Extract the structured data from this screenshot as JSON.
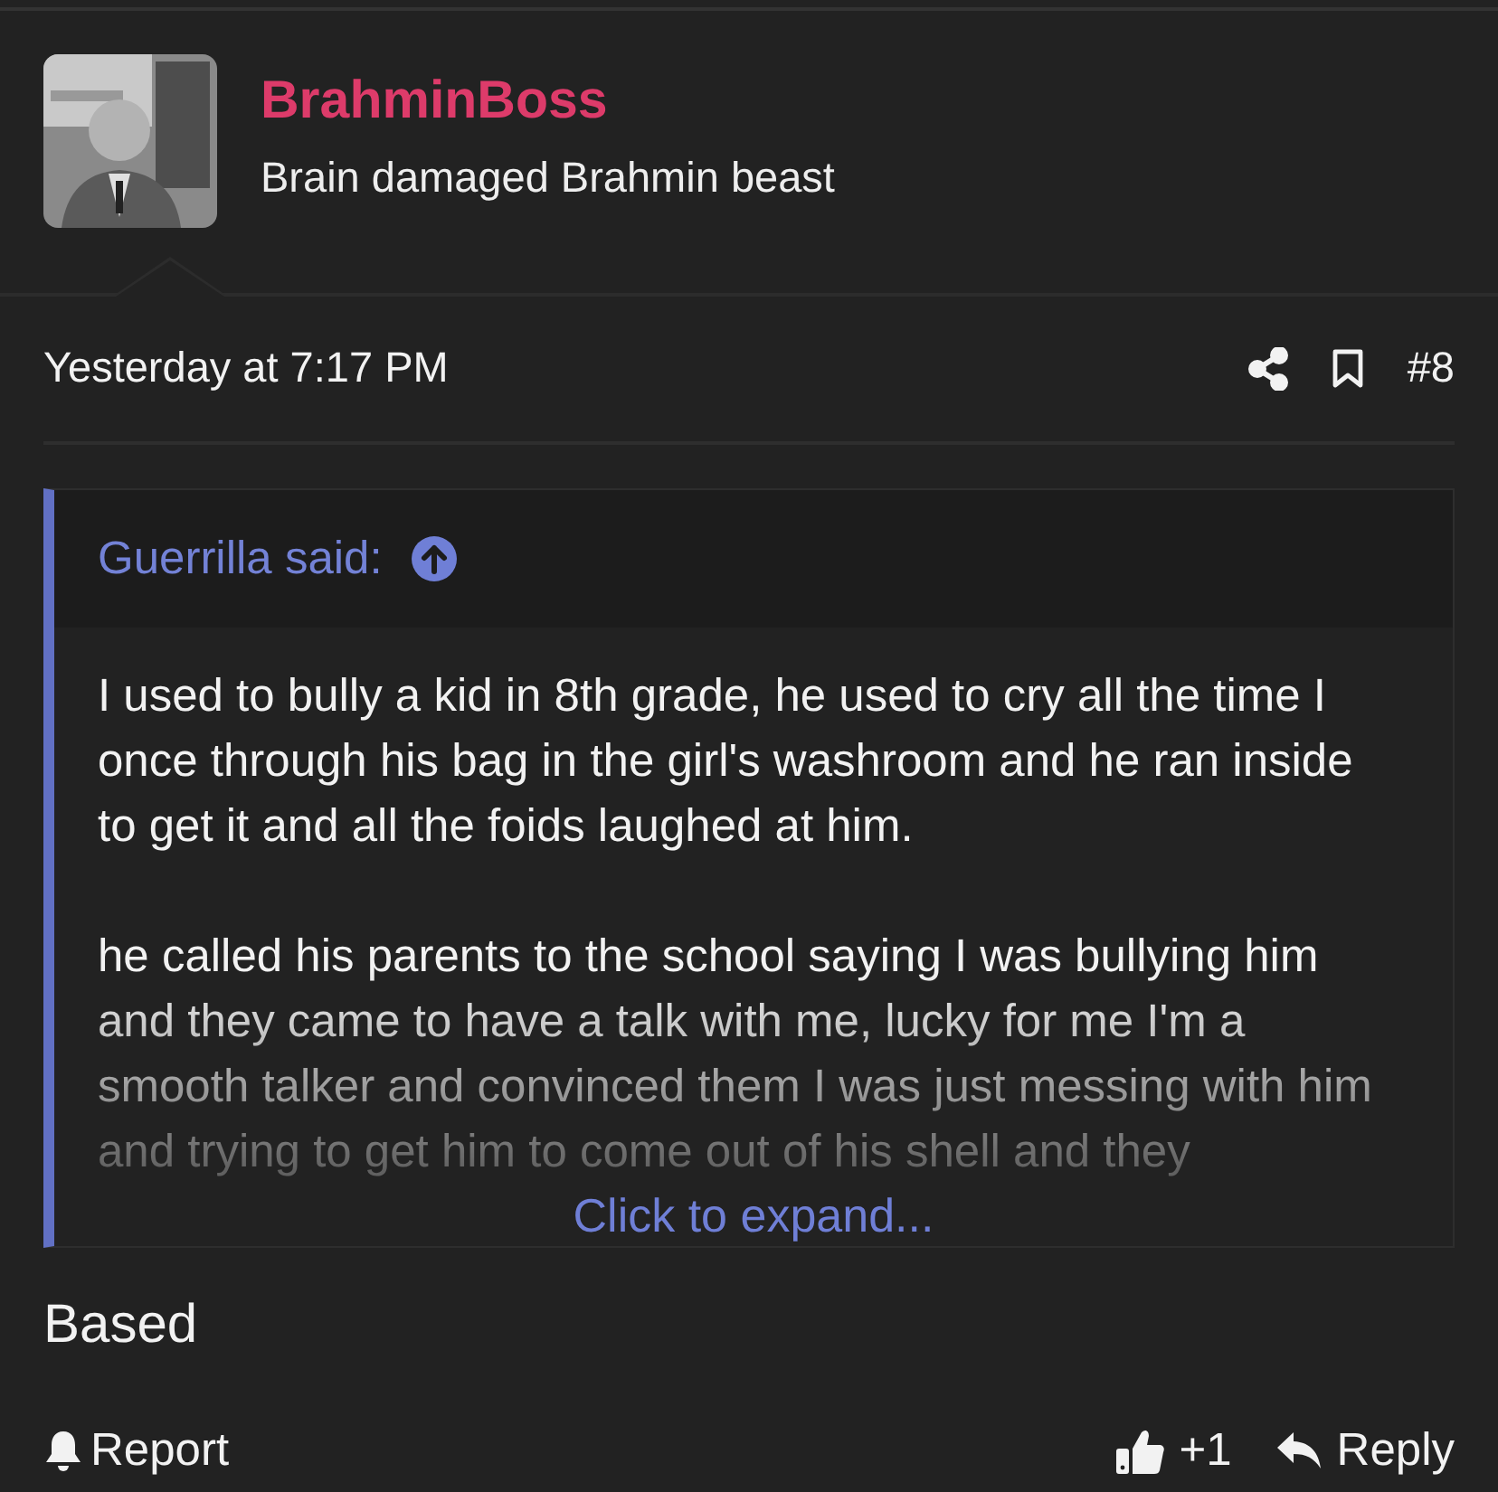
{
  "author": {
    "name": "BrahminBoss",
    "title": "Brain damaged Brahmin beast"
  },
  "post": {
    "date": "Yesterday at 7:17 PM",
    "number": "#8"
  },
  "quote": {
    "attribution": "Guerrilla said:",
    "paragraphs": [
      "I used to bully a kid in 8th grade, he used to cry all the time I once through his bag in the girl's washroom and he ran inside to get it and all the foids laughed at him.",
      "he called his parents to the school saying I was bullying him and they came to have a talk with me, lucky for me I'm a smooth talker and convinced them I was just messing with him and trying to get him to come out of his shell and they"
    ],
    "expand": "Click to expand..."
  },
  "body": "Based",
  "actions": {
    "report": "Report",
    "reactions": "+1",
    "reply": "Reply"
  }
}
